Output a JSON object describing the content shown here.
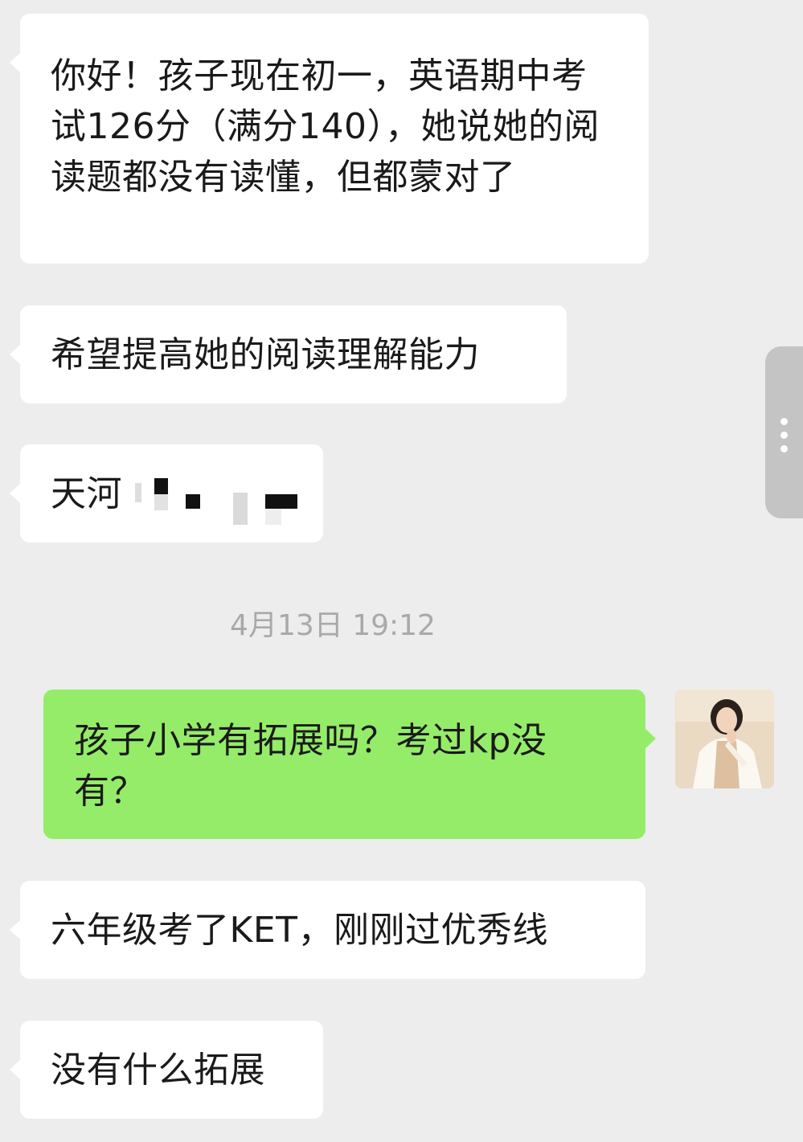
{
  "messages": [
    {
      "id": "m1",
      "side": "left",
      "text": "你好！孩子现在初一，英语期中考试126分（满分140），她说她的阅读题都没有读懂，但都蒙对了"
    },
    {
      "id": "m2",
      "side": "left",
      "text": "希望提高她的阅读理解能力"
    },
    {
      "id": "m3",
      "side": "left",
      "text": "天河",
      "note_redacted": true
    },
    {
      "id": "m4",
      "side": "right",
      "text": "孩子小学有拓展吗？考过kp没有？"
    },
    {
      "id": "m5",
      "side": "left",
      "text": "六年级考了KET，刚刚过优秀线"
    },
    {
      "id": "m6",
      "side": "left",
      "text": "没有什么拓展"
    }
  ],
  "timestamp": "4月13日 19:12",
  "colors": {
    "background": "#ededed",
    "incoming_bubble": "#ffffff",
    "outgoing_bubble": "#95ec69",
    "timestamp_text": "#a9a9a9"
  },
  "icons": {
    "avatar": "user-avatar-photo",
    "side_handle": "more-vertical-dots-icon"
  }
}
